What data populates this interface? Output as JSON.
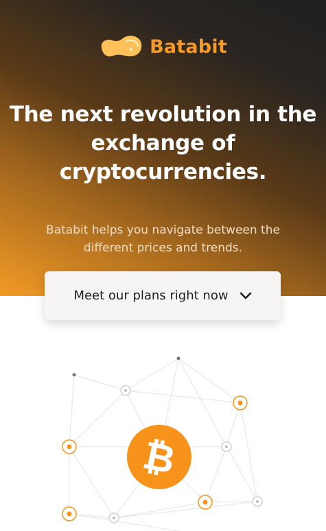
{
  "brand": {
    "name": "Batabit",
    "accent_color": "#f39a2a"
  },
  "hero": {
    "headline_lines": [
      "The next revolution in the",
      "exchange of",
      "cryptocurrencies."
    ],
    "subtitle_lines": [
      "Batabit helps you navigate between the",
      "different prices and trends."
    ]
  },
  "cta": {
    "label": "Meet our plans right now",
    "icon": "chevron-down-icon"
  },
  "illustration": {
    "center_icon": "bitcoin-icon",
    "node_icons": [
      "network-node-icon"
    ]
  }
}
